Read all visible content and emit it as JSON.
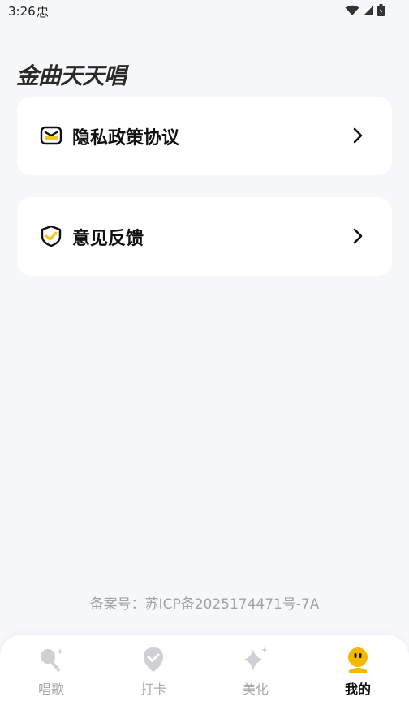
{
  "status": {
    "time": "3:26",
    "debug_glyph": "忠",
    "icons": [
      "wifi-icon",
      "signal-icon",
      "battery-icon"
    ]
  },
  "app": {
    "title": "金曲天天唱"
  },
  "menu": [
    {
      "label": "隐私政策协议",
      "icon": "envelope-icon"
    },
    {
      "label": "意见反馈",
      "icon": "shield-check-icon"
    }
  ],
  "footer": {
    "icp": "备案号：苏ICP备2025174471号-7A"
  },
  "nav": {
    "items": [
      {
        "label": "唱歌",
        "icon": "microphone-icon",
        "active": false
      },
      {
        "label": "打卡",
        "icon": "location-check-icon",
        "active": false
      },
      {
        "label": "美化",
        "icon": "sparkle-icon",
        "active": false
      },
      {
        "label": "我的",
        "icon": "profile-icon",
        "active": true
      }
    ]
  },
  "colors": {
    "accent": "#f5c518",
    "background": "#f6f7f9",
    "card": "#ffffff",
    "muted": "#a9aaae"
  }
}
